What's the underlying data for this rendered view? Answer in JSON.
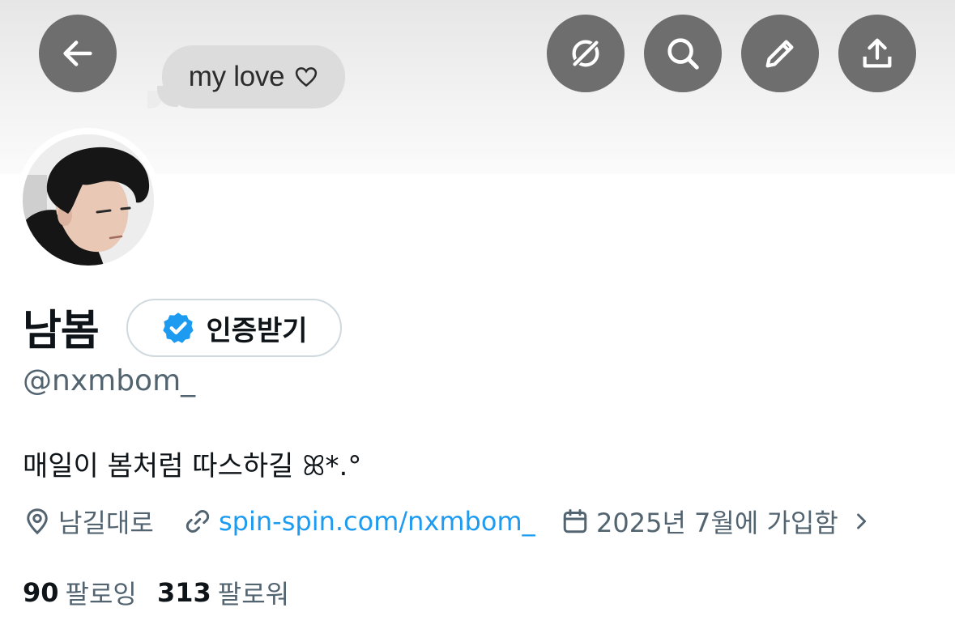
{
  "banner": {
    "bubble_text": "my love"
  },
  "header_buttons": {
    "back": "back-arrow-icon",
    "grok": "grok-icon",
    "search": "search-icon",
    "edit": "pencil-icon",
    "share": "share-icon"
  },
  "profile": {
    "name": "남봄",
    "verify_label": "인증받기",
    "handle": "@nxmbom_",
    "bio": "매일이 봄처럼 따스하길 ꕤ*.°",
    "location": "남길대로",
    "website": "spin-spin.com/nxmbom_",
    "joined": "2025년 7월에 가입함"
  },
  "stats": {
    "following_count": "90",
    "following_label": "팔로잉",
    "followers_count": "313",
    "followers_label": "팔로워"
  },
  "colors": {
    "accent": "#1d9bf0",
    "secondary_text": "#536471",
    "button_bg": "#6e6e6e"
  }
}
